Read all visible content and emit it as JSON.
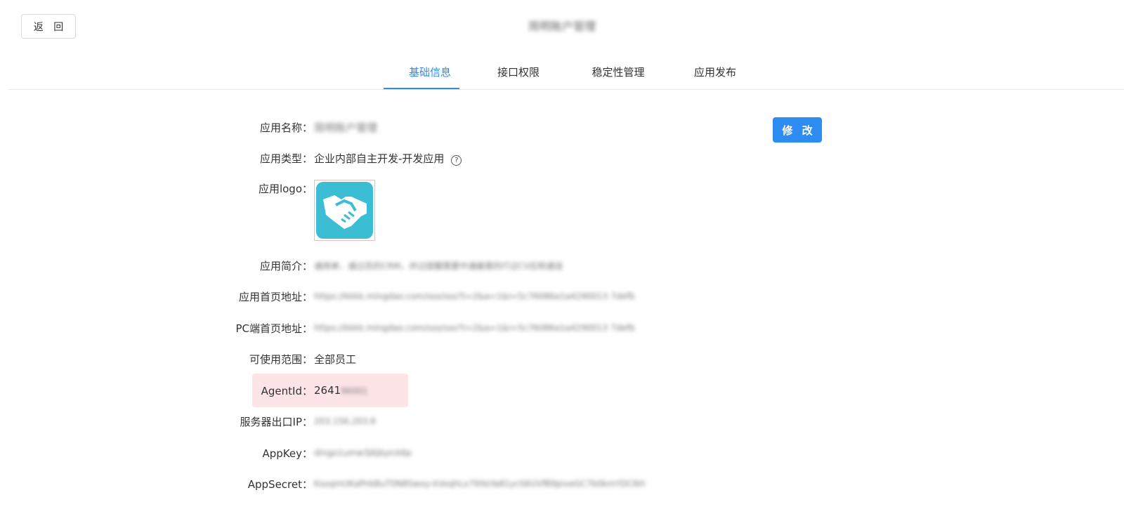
{
  "header": {
    "back_label": "返 回",
    "title": "简明账户管理"
  },
  "tabs": [
    {
      "label": "基础信息",
      "active": true
    },
    {
      "label": "接口权限",
      "active": false
    },
    {
      "label": "稳定性管理",
      "active": false
    },
    {
      "label": "应用发布",
      "active": false
    }
  ],
  "edit_label": "修 改",
  "fields": {
    "app_name": {
      "label": "应用名称：",
      "value": "简明账户管理"
    },
    "app_type": {
      "label": "应用类型：",
      "value": "企业内部自主开发-开发应用"
    },
    "app_logo": {
      "label": "应用logo："
    },
    "app_intro": {
      "label": "应用简介：",
      "value": "通用单，通过员的CRM，并过提醒需要中通最需的IT过CV应和通说"
    },
    "home_url": {
      "label": "应用首页地址：",
      "value": "https://kkkk.mingdao.com/sso/sso?t=2&a=1&i=5c76086a1a4290013 7defb"
    },
    "pc_home_url": {
      "label": "PC端首页地址：",
      "value": "https://kkkk.mingdao.com/sso/sso?t=2&a=1&i=5c76086a1a4290013 7defb"
    },
    "scope": {
      "label": "可使用范围：",
      "value": "全部员工"
    },
    "agent_id": {
      "label": "AgentId：",
      "value_visible": "2641",
      "value_hidden": "96001"
    },
    "server_ip": {
      "label": "服务器出口IP：",
      "value": "203.156.203.8"
    },
    "app_key": {
      "label": "AppKey：",
      "value": "dingo1umw3j6jbyick6p"
    },
    "app_secret": {
      "label": "AppSecret：",
      "value": "KsoqmUKaPnkBuT0N8Swoy-kVoqhLx79XeYa81ycS6UVfB9piveGC7b0kmYDC6H"
    }
  },
  "colors": {
    "accent": "#2d8cf0",
    "logo_bg": "#3bbdd3",
    "highlight": "#fde4e6"
  },
  "icons": {
    "help": "question-circle-icon",
    "logo": "handshake-icon"
  }
}
